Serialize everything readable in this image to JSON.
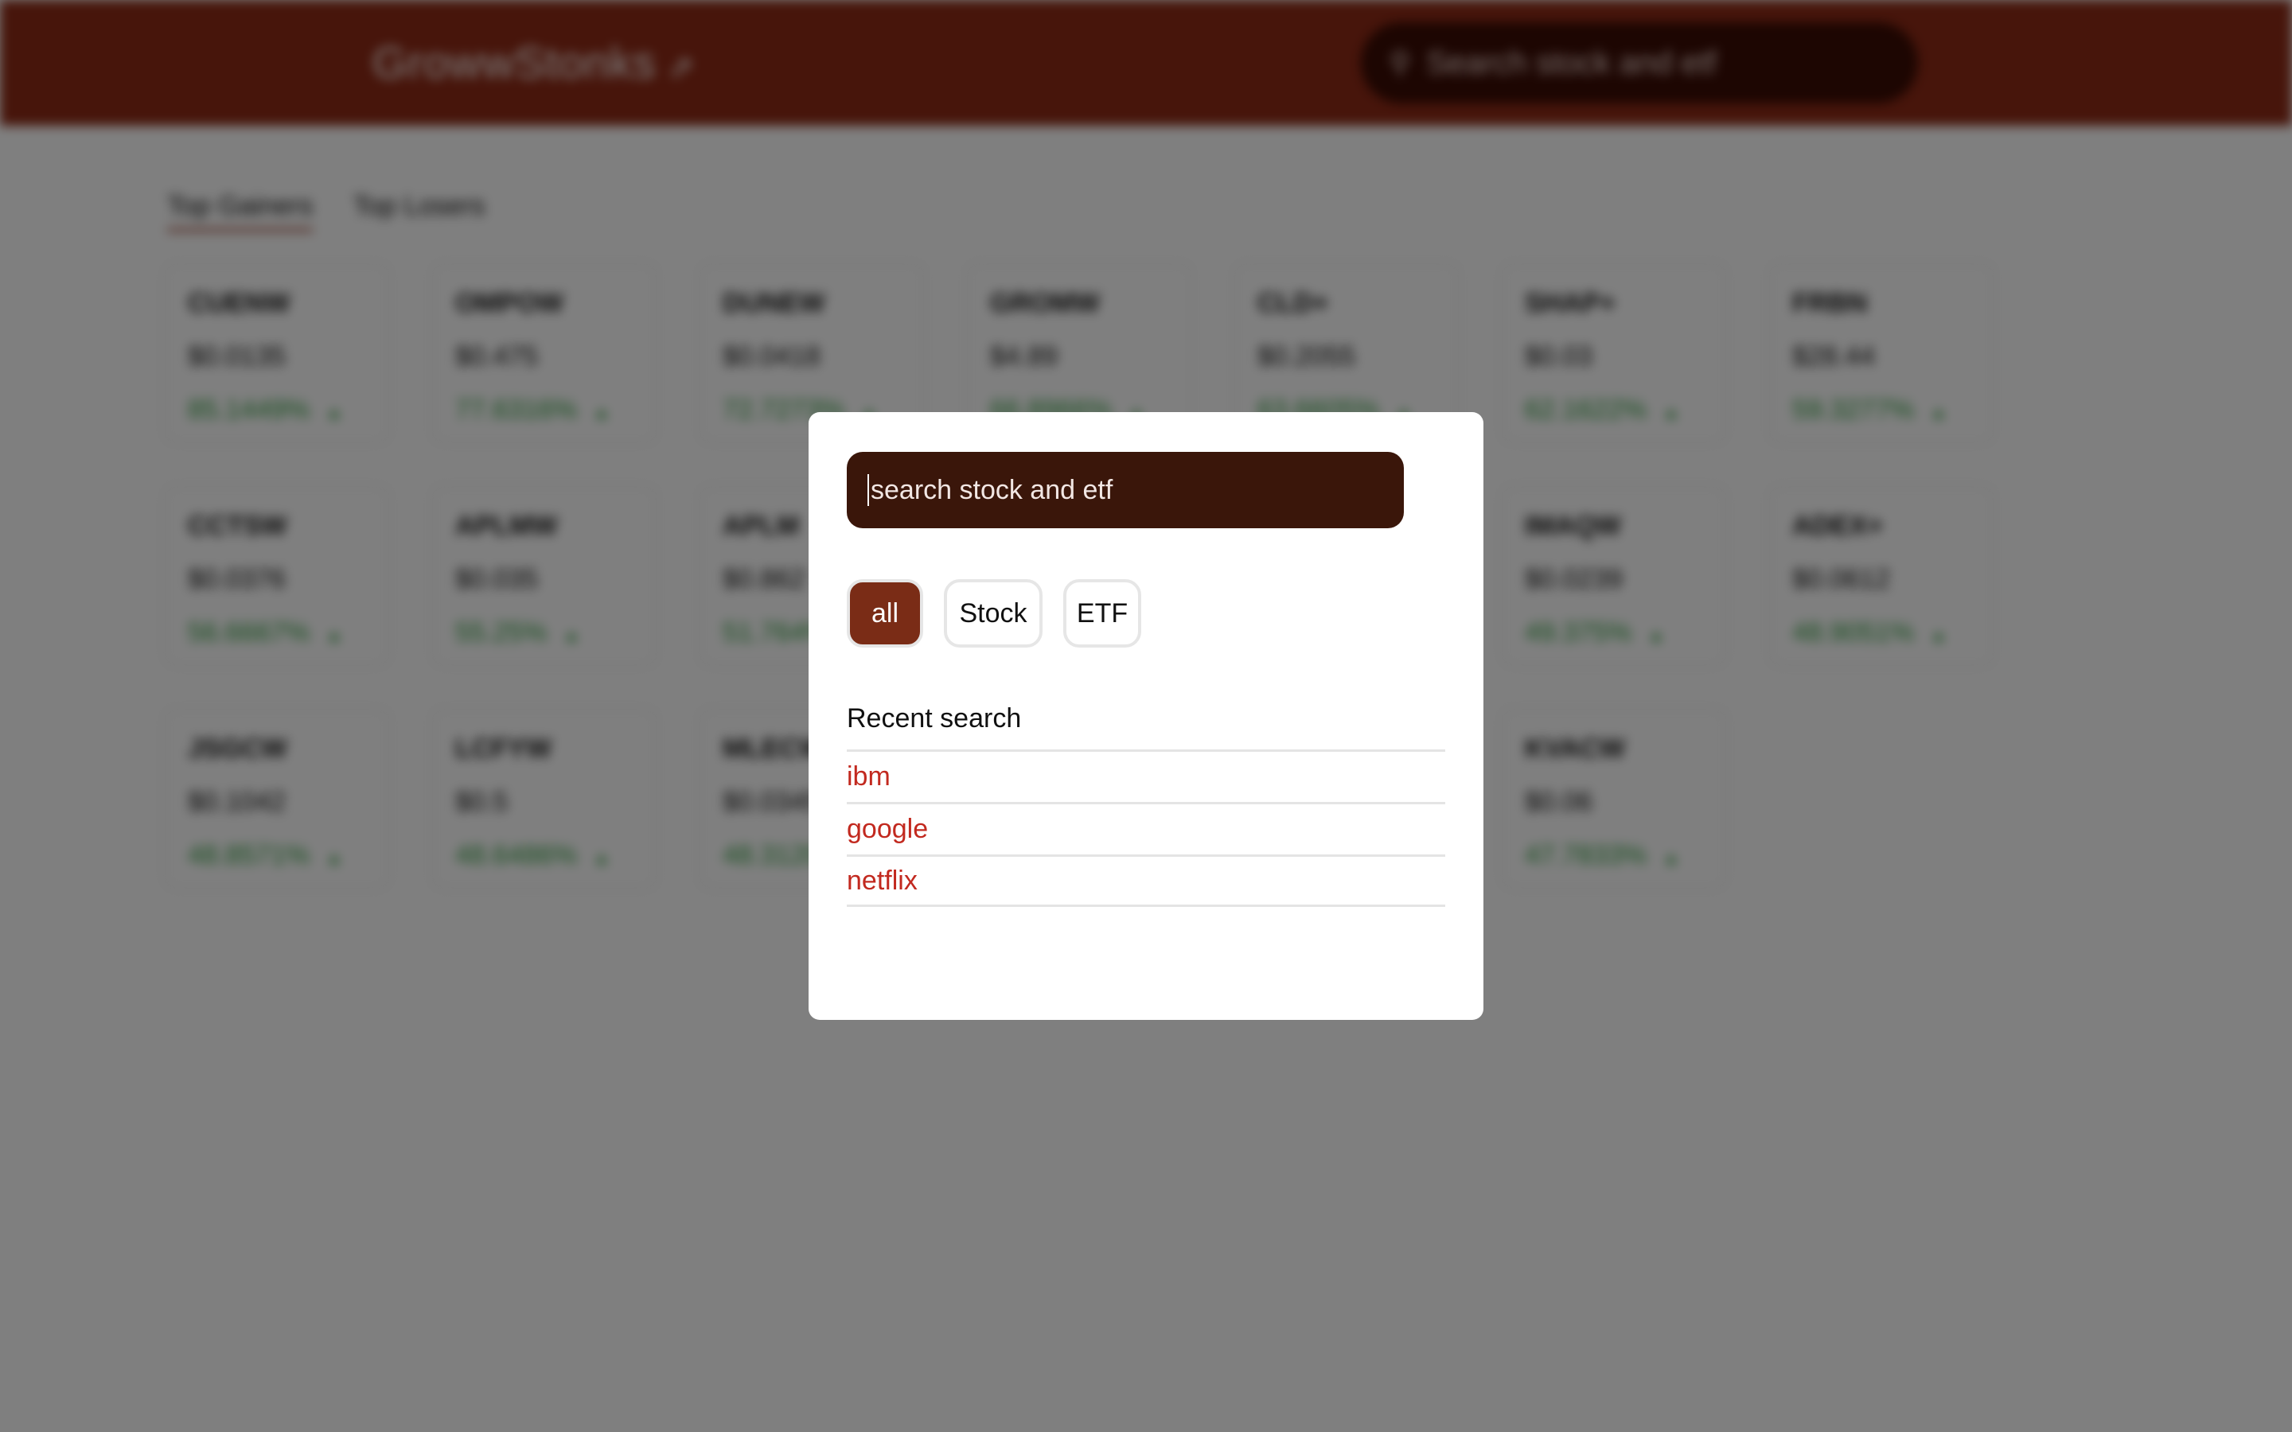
{
  "app": {
    "brand": "GrowwStonks",
    "brand_icon": "trend-line-icon",
    "header_search_placeholder": "Search stock and etf",
    "colors": {
      "header": "#8e2a16",
      "modal_search_bg": "#3a160a",
      "active_filter": "#7a2c16",
      "recent_link": "#c2291f",
      "gain": "#2c9b3a"
    }
  },
  "tabs": [
    {
      "label": "Top Gainers",
      "active": true
    },
    {
      "label": "Top Losers",
      "active": false
    }
  ],
  "cards": [
    {
      "symbol": "CUENW",
      "price": "$0.0135",
      "change": "85.1449%"
    },
    {
      "symbol": "OMPOW",
      "price": "$0.475",
      "change": "77.6316%"
    },
    {
      "symbol": "DUNEW",
      "price": "$0.0418",
      "change": "72.7273%"
    },
    {
      "symbol": "GROMW",
      "price": "$4.89",
      "change": "66.8966%"
    },
    {
      "symbol": "CLD+",
      "price": "$0.2055",
      "change": "63.6605%"
    },
    {
      "symbol": "SHAP+",
      "price": "$0.03",
      "change": "62.1622%"
    },
    {
      "symbol": "FRBN",
      "price": "$28.44",
      "change": "59.3277%"
    },
    {
      "symbol": "CCTSW",
      "price": "$0.0376",
      "change": "56.6667%"
    },
    {
      "symbol": "APLMW",
      "price": "$0.035",
      "change": "55.25%"
    },
    {
      "symbol": "APLM",
      "price": "$0.862",
      "change": "51.764%"
    },
    {
      "symbol": "",
      "price": "",
      "change": ""
    },
    {
      "symbol": "",
      "price": "",
      "change": ""
    },
    {
      "symbol": "IMAQW",
      "price": "$0.0239",
      "change": "49.375%"
    },
    {
      "symbol": "ADEX+",
      "price": "$0.0612",
      "change": "48.9051%"
    },
    {
      "symbol": "JSGCW",
      "price": "$0.1042",
      "change": "48.8571%"
    },
    {
      "symbol": "LCFYW",
      "price": "$0.5",
      "change": "48.6486%"
    },
    {
      "symbol": "MLECW",
      "price": "$0.0345",
      "change": "48.3120%"
    },
    {
      "symbol": "",
      "price": "",
      "change": ""
    },
    {
      "symbol": "",
      "price": "",
      "change": ""
    },
    {
      "symbol": "KVACW",
      "price": "$0.06",
      "change": "47.7833%"
    }
  ],
  "modal": {
    "search_placeholder": "search stock and etf",
    "filters": [
      {
        "label": "all",
        "active": true
      },
      {
        "label": "Stock",
        "active": false
      },
      {
        "label": "ETF",
        "active": false
      }
    ],
    "recent_title": "Recent search",
    "recent": [
      "ibm",
      "google",
      "netflix"
    ]
  }
}
